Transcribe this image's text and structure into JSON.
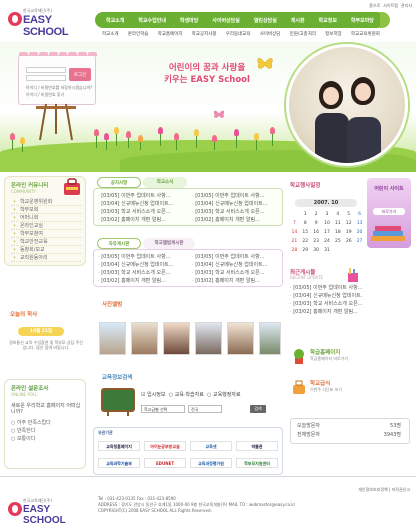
{
  "header": {
    "util_links": [
      "홈으로",
      "사이트맵",
      "관리자"
    ],
    "logo_sub": "한국교육재단(주)",
    "logo_main": "EASY SCHOOL",
    "gnb": [
      "학교소개",
      "학교수업안내",
      "학생마당",
      "사이버상담실",
      "열린상담실",
      "게시판",
      "학교정보",
      "학부모마당"
    ],
    "snb": [
      "학교소개",
      "온라인학습",
      "학교홈페이지",
      "학교공지사항",
      "우리동네교육",
      "사이버상담",
      "민원/고충처리",
      "정보저장",
      "학교교육위원회"
    ]
  },
  "hero": {
    "login_save": "아이디 / 비밀번호를 저장하시겠습니까?",
    "login_find": "아이디 / 비밀번호 찾기",
    "login_button": "로그인",
    "slogan_line1": "어린이의 꿈과 사랑을",
    "slogan_line2": "키우는 EASY School"
  },
  "left": {
    "community_title": "온라인 커뮤니티",
    "community_sub": "COMMUNITY",
    "community_items": [
      "학교운영위원회",
      "학부모회",
      "어머니회",
      "온라인교실",
      "학부모참여",
      "학교안전교육",
      "동창회/모교",
      "교직원동아리"
    ],
    "notice_title": "오늘의 학사",
    "notice_date": "10월 21일",
    "notice_body": "정보통신 교육 수업참관 및 학부모 상담 주간입니다. 많은 참여 바랍니다.",
    "poll_title": "온라인 설문조사",
    "poll_sub": "ONLINE POLL",
    "poll_question": "새로운 우리학교 홈페이지 어떠십니까?",
    "poll_options": [
      "아주 만족스럽다",
      "만족한다",
      "보통이다"
    ]
  },
  "center": {
    "board1_tabs": [
      "공지사항",
      "학교소식"
    ],
    "board1_left": [
      "[03/05] 이번주 업데이트 사항...",
      "[03/04] 신규메뉴신청 업데이트...",
      "[03/03] 학교 서비스소개 오픈...",
      "[03/02] 홈페이지 개편 알림..."
    ],
    "board1_right": [
      "[03/05] 이번주 업데이트 사항...",
      "[03/04] 신규메뉴신청 업데이트...",
      "[03/03] 학교 서비스소개 오픈...",
      "[03/02] 홈페이지 개편 알림..."
    ],
    "board2_tabs": [
      "자유게시판",
      "학교앨범게시판"
    ],
    "board2_left": [
      "[03/05] 이번주 업데이트 사항...",
      "[03/04] 신규메뉴신청 업데이트...",
      "[03/03] 학교 서비스소개 오픈...",
      "[03/02] 홈페이지 개편 알림..."
    ],
    "board2_right": [
      "[03/05] 이번주 업데이트 사항...",
      "[03/04] 신규메뉴신청 업데이트...",
      "[03/03] 학교 서비스소개 오픈...",
      "[03/02] 홈페이지 개편 알림..."
    ],
    "gallery_title": "사진앨범",
    "search_title": "교육정보검색",
    "search_radios": [
      "입시정보",
      "교육·학습자료",
      "교육행정자료"
    ],
    "search_select1": "학교급별 선택",
    "search_select2": "전국",
    "search_button": "검색",
    "partners_title": "유관기관",
    "partners": [
      "교육청홈페이지",
      "아이눈공부방교실",
      "교육넷",
      "박물관",
      "교육과학기술부",
      "EDUNET",
      "교육과정평가원",
      "학부모지원센터"
    ]
  },
  "right": {
    "calendar_title": "학교행사일정",
    "calendar_month": "2007. 10",
    "calendar_days_head": [
      "S",
      "M",
      "T",
      "W",
      "T",
      "F",
      "S"
    ],
    "calendar_days": [
      "",
      "1",
      "2",
      "3",
      "4",
      "5",
      "6",
      "7",
      "8",
      "9",
      "10",
      "11",
      "12",
      "13",
      "14",
      "15",
      "16",
      "17",
      "18",
      "19",
      "20",
      "21",
      "22",
      "23",
      "24",
      "25",
      "26",
      "27",
      "28",
      "29",
      "30",
      "31",
      "",
      "",
      ""
    ],
    "banner_text": "어린이 사이트",
    "banner_button": "바로가기",
    "recent_title": "최근게시물",
    "recent_sub": "RECENT UPDATE",
    "recent_items": [
      "[03/05] 이번주 업데이트 사항...",
      "[03/04] 신규메뉴신청 업데이트...",
      "[03/03] 학교 서비스소개 오픈...",
      "[03/02] 홈페이지 개편 알림..."
    ],
    "quick1_title": "학급홈페이지",
    "quick1_sub": "학급홈페이지 바로가기",
    "quick2_title": "학교급식",
    "quick2_sub": "이번주 식단표 보기",
    "stats": [
      {
        "label": "오늘방문자",
        "value": "53명"
      },
      {
        "label": "전체방문자",
        "value": "3943명"
      }
    ]
  },
  "footer": {
    "links": [
      "개인정보보호정책",
      "저작권신고"
    ],
    "address": "Tel : 031-423-0135  Fax : 031-423-8590",
    "address2": "ADDRESS : 경기도 안양시 동안구 호계1동 1000-00 9층 한국교육개발(주)  MAIL TO : webmaster@easy.co.kr",
    "copyright": "COPYRIGHT(C) 2008 EASY SCHOOL ALL Rights Reserved."
  },
  "colors": {
    "accent_green": "#6bb033",
    "accent_pink": "#e8738f",
    "accent_purple": "#6a3ea0"
  }
}
